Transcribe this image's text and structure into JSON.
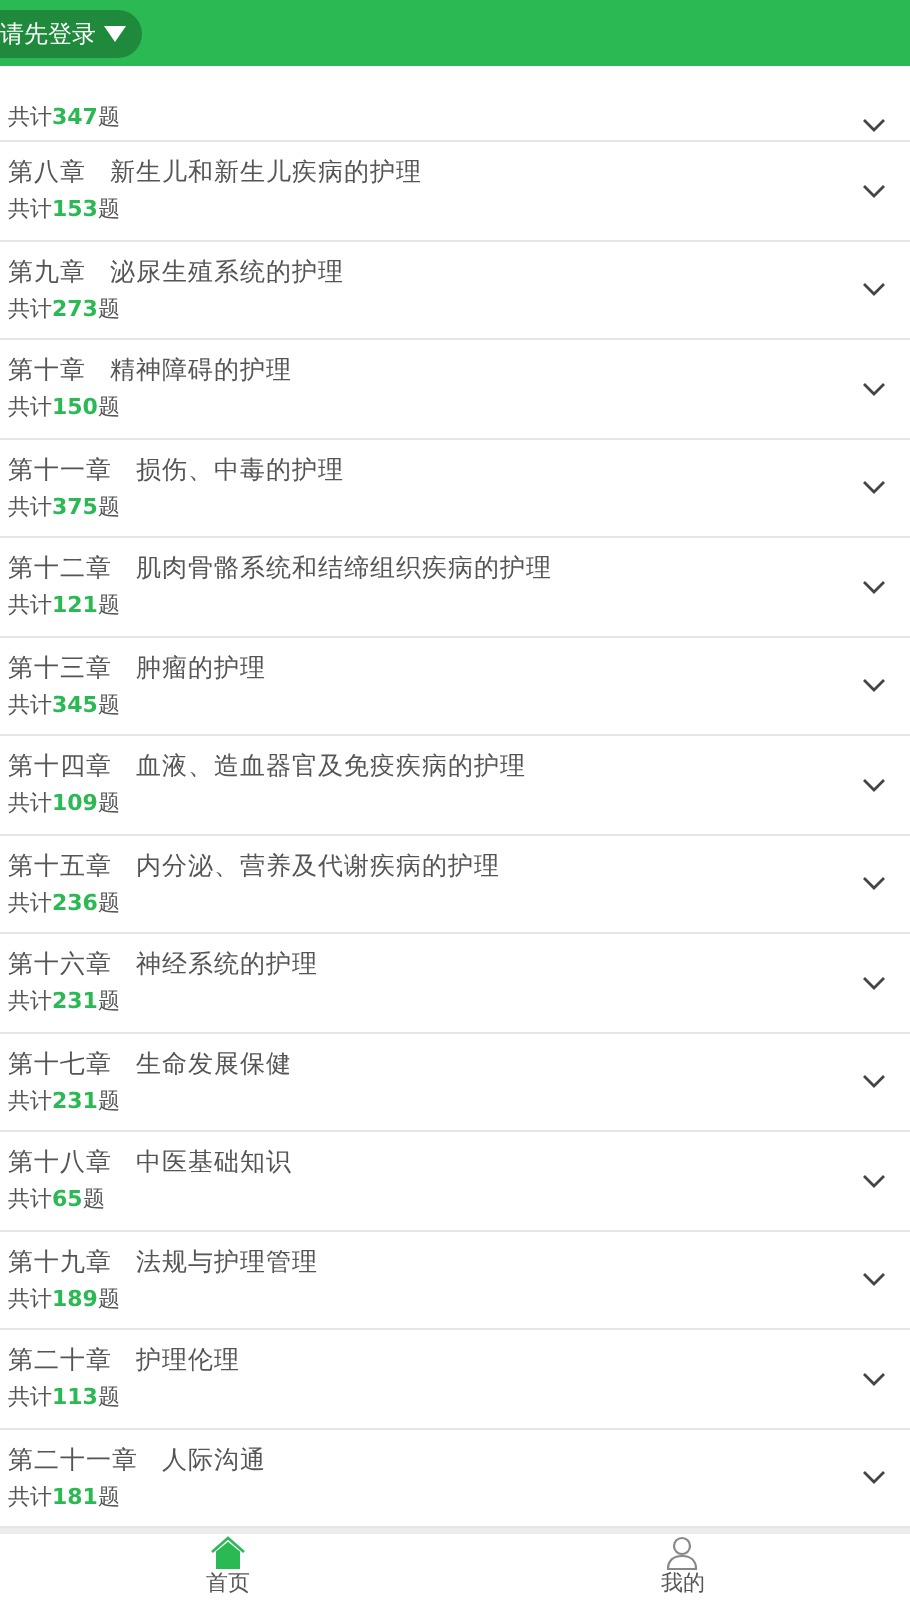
{
  "header": {
    "login_button": "请先登录"
  },
  "chapters": [
    {
      "count": "共计**347**题",
      "expanded": false
    },
    {
      "chapter": "第八章",
      "name": "新生儿和新生儿疾病的护理",
      "count": "共计**153**题",
      "expanded": false
    },
    {
      "chapter": "第九章",
      "name": "泌尿生殖系统的护理",
      "count": "共计**273**题",
      "expanded": false
    },
    {
      "chapter": "第十章",
      "name": "精神障碍的护理",
      "count": "共计**150**题",
      "expanded": false
    },
    {
      "chapter": "第十一章",
      "name": "损伤、中毒的护理",
      "count": "共计**375**题",
      "expanded": false
    },
    {
      "chapter": "第十二章",
      "name": "肌肉骨骼系统和结缔组织疾病的护理",
      "count": "共计**121**题",
      "expanded": false
    },
    {
      "chapter": "第十三章",
      "name": "肿瘤的护理",
      "count": "共计**345**题",
      "expanded": false
    },
    {
      "chapter": "第十四章",
      "name": "血液、造血器官及免疫疾病的护理",
      "count": "共计**109**题",
      "expanded": false
    },
    {
      "chapter": "第十五章",
      "name": "内分泌、营养及代谢疾病的护理",
      "count": "共计**236**题",
      "expanded": false
    },
    {
      "chapter": "第十六章",
      "name": "神经系统的护理",
      "count": "共计**231**题",
      "expanded": false
    },
    {
      "chapter": "第十七章",
      "name": "生命发展保健",
      "count": "共计**231**题",
      "expanded": false
    },
    {
      "chapter": "第十八章",
      "name": "中医基础知识",
      "count": "共计**65**题",
      "expanded": false
    },
    {
      "chapter": "第十九章",
      "name": "法规与护理管理",
      "count": "共计**189**题",
      "expanded": false
    },
    {
      "chapter": "第二十章",
      "name": "护理伦理",
      "count": "共计**113**题",
      "expanded": false
    },
    {
      "chapter": "第二十一章",
      "name": "人际沟通",
      "count": "共计**181**题",
      "expanded": false
    }
  ],
  "tab_bar": [
    {
      "kind": "home",
      "label": "首页",
      "selected": true
    },
    {
      "kind": "profile",
      "label": "我的",
      "selected": false
    }
  ]
}
